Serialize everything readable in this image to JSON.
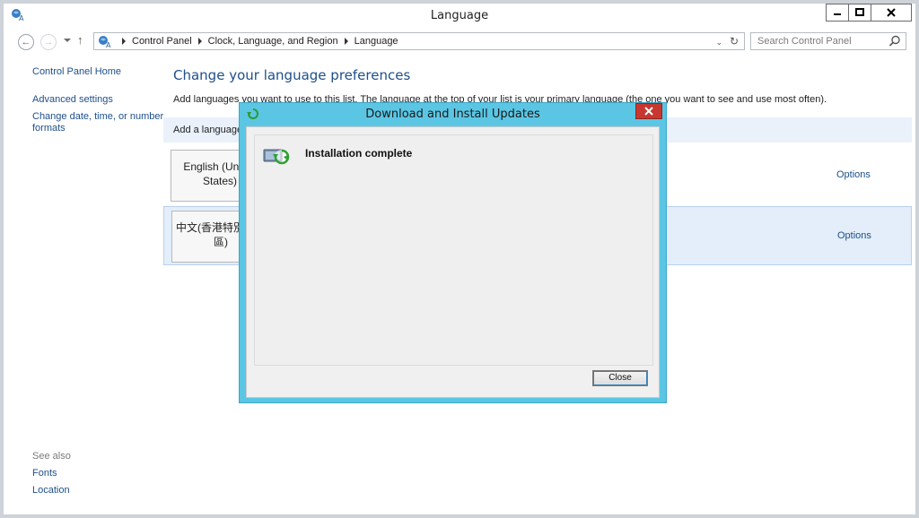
{
  "window": {
    "title": "Language"
  },
  "address": {
    "crumbs": [
      "Control Panel",
      "Clock, Language, and Region",
      "Language"
    ],
    "search_placeholder": "Search Control Panel"
  },
  "sidebar": {
    "home": "Control Panel Home",
    "links": [
      "Advanced settings",
      "Change date, time, or number formats"
    ],
    "see_also_label": "See also",
    "see_also": [
      "Fonts",
      "Location"
    ]
  },
  "main": {
    "heading": "Change your language preferences",
    "description": "Add languages you want to use to this list. The language at the top of your list is your primary language (the one you want to see and use most often).",
    "add_language": "Add a language",
    "languages": [
      {
        "name": "English (United States)",
        "options": "Options"
      },
      {
        "name": "中文(香港特別行政區)",
        "options": "Options"
      }
    ]
  },
  "dialog": {
    "title": "Download and Install Updates",
    "status": "Installation complete",
    "close_button": "Close"
  },
  "colors": {
    "dialog_frame": "#5bc6e4",
    "close_red": "#c7372f",
    "link_blue": "#1e4f8a",
    "selected_row": "#e3eefa"
  }
}
